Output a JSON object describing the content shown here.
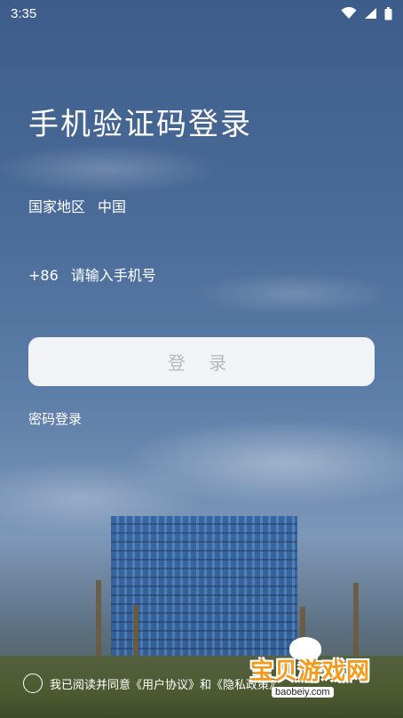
{
  "status_bar": {
    "time": "3:35",
    "icons": [
      "wifi-icon",
      "signal-icon",
      "battery-icon"
    ]
  },
  "page": {
    "title": "手机验证码登录"
  },
  "region": {
    "label": "国家地区",
    "value": "中国"
  },
  "phone": {
    "country_code": "+86",
    "placeholder": "请输入手机号",
    "value": ""
  },
  "login_button": {
    "label": "登 录"
  },
  "password_login": {
    "label": "密码登录"
  },
  "agreement": {
    "text": "我已阅读并同意《用户协议》和《隐私政策》",
    "checked": false
  },
  "watermark": {
    "title": "宝贝游戏网",
    "url": "baobeiy.com"
  },
  "colors": {
    "button_bg": "#f2f3f6",
    "button_text": "#b7b8bc",
    "text": "#ffffff"
  }
}
